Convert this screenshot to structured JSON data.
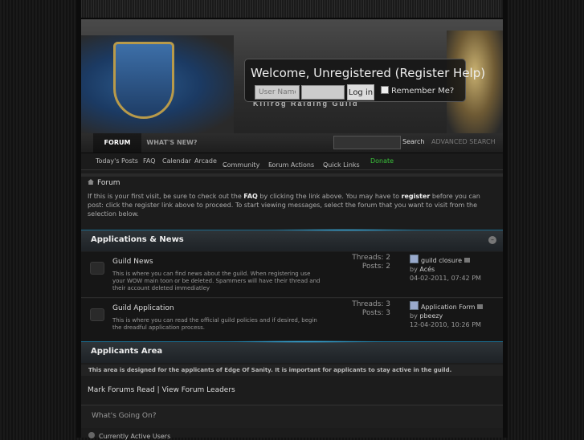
{
  "header": {
    "guild_name": "Killrog Raiding Guild"
  },
  "login": {
    "welcome": "Welcome, Unregistered (Register Help)",
    "username_placeholder": "User Name",
    "login_button": "Log in",
    "remember_me": "Remember Me?"
  },
  "navbar": {
    "tab_forum": "FORUM",
    "tab_whats_new": "WHAT'S NEW?",
    "search_button": "Search",
    "advanced_search": "ADVANCED SEARCH"
  },
  "subnav": {
    "todays_posts": "Today's Posts",
    "faq": "FAQ",
    "calendar": "Calendar",
    "arcade": "Arcade",
    "community": "Community",
    "forum_actions": "Forum Actions",
    "quick_links": "Quick Links",
    "donate": "Donate"
  },
  "breadcrumb": {
    "current": "Forum"
  },
  "notice": {
    "part1": "If this is your first visit, be sure to check out the ",
    "faq": "FAQ",
    "part2": " by clicking the link above. You may have to ",
    "register": "register",
    "part3": " before you can post: click the register link above to proceed. To start viewing messages, select the forum that you want to visit from the selection below."
  },
  "sections": {
    "applications": {
      "title": "Applications & News",
      "forums": [
        {
          "name": "Guild News",
          "description": "This is where you can find news about the guild. When registering use your WOW main toon or be deleted. Spammers will have their thread and their account deleted immediatley",
          "threads": "Threads: 2",
          "posts": "Posts: 2",
          "last_title": "guild closure",
          "last_by_label": "by",
          "last_by": "Acés",
          "last_date": "04-02-2011,",
          "last_time": "07:42 PM"
        },
        {
          "name": "Guild Application",
          "description": "This is where you can read the official guild policies and if desired, begin the dreadful application process.",
          "threads": "Threads: 3",
          "posts": "Posts: 3",
          "last_title": "Application Form",
          "last_by_label": "by",
          "last_by": "pbeezy",
          "last_date": "12-04-2010,",
          "last_time": "10:26 PM"
        }
      ]
    },
    "applicants": {
      "title": "Applicants Area",
      "note": "This area is designed for the applicants of Edge Of Sanity. It is important for applicants to stay active in the guild."
    }
  },
  "footer": {
    "mark_read": "Mark Forums Read",
    "separator": "|",
    "view_leaders": "View Forum Leaders",
    "whats_going_on": "What's Going On?",
    "active_users": "Currently Active Users"
  },
  "colors": {
    "accent": "#3aa8d8",
    "donate": "#3ac13a"
  }
}
